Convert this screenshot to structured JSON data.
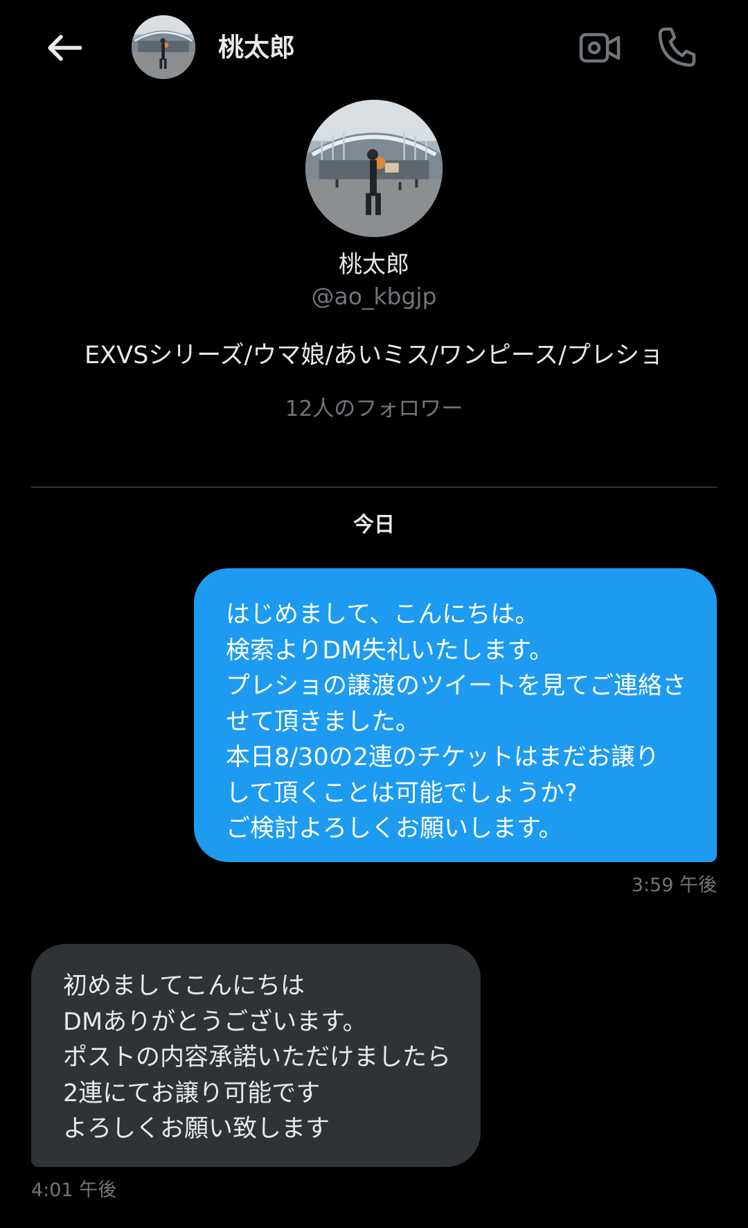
{
  "header": {
    "back_icon": "arrow-left-icon",
    "name": "桃太郎",
    "video_icon": "video-camera-icon",
    "call_icon": "phone-icon"
  },
  "profile": {
    "name": "桃太郎",
    "handle": "@ao_kbgjp",
    "bio": "EXVSシリーズ/ウマ娘/あいミス/ワンピース/プレショ",
    "followers": "12人のフォロワー"
  },
  "conversation": {
    "date_separator": "今日",
    "messages": [
      {
        "direction": "sent",
        "lines": [
          "はじめまして、こんにちは。",
          "検索よりDM失礼いたします。",
          "プレショの譲渡のツイートを見てご連絡さ",
          "せて頂きました。",
          "本日8/30の2連のチケットはまだお譲り",
          "して頂くことは可能でしょうか?",
          "ご検討よろしくお願いします。"
        ],
        "time": "3:59 午後"
      },
      {
        "direction": "received",
        "lines": [
          "初めましてこんにちは",
          "DMありがとうございます。",
          "ポストの内容承諾いただけましたら",
          "2連にてお譲り可能です",
          "よろしくお願い致します"
        ],
        "time": "4:01 午後"
      }
    ]
  },
  "colors": {
    "background": "#000000",
    "sent_bubble": "#1d9bf0",
    "received_bubble": "#2f3336",
    "primary_text": "#e7e9ea",
    "secondary_text": "#71767b"
  }
}
